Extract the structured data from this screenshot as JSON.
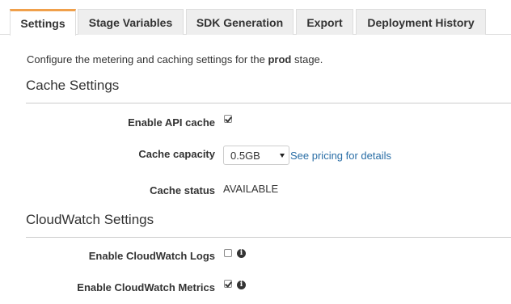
{
  "tabs": [
    {
      "label": "Settings",
      "active": true
    },
    {
      "label": "Stage Variables",
      "active": false
    },
    {
      "label": "SDK Generation",
      "active": false
    },
    {
      "label": "Export",
      "active": false
    },
    {
      "label": "Deployment History",
      "active": false
    }
  ],
  "intro": {
    "prefix": "Configure the metering and caching settings for the ",
    "stage": "prod",
    "suffix": " stage."
  },
  "cache_settings": {
    "title": "Cache Settings",
    "enable_api_cache": {
      "label": "Enable API cache",
      "checked": true
    },
    "cache_capacity": {
      "label": "Cache capacity",
      "value": "0.5GB",
      "link": "See pricing for details"
    },
    "cache_status": {
      "label": "Cache status",
      "value": "AVAILABLE"
    }
  },
  "cloudwatch_settings": {
    "title": "CloudWatch Settings",
    "enable_logs": {
      "label": "Enable CloudWatch Logs",
      "checked": false,
      "icon": "info-icon"
    },
    "enable_metrics": {
      "label": "Enable CloudWatch Metrics",
      "checked": true,
      "icon": "info-icon"
    }
  },
  "colors": {
    "active_tab_accent": "#f0a04b",
    "link": "#2a6ea6",
    "tab_background": "#eeeeee"
  }
}
